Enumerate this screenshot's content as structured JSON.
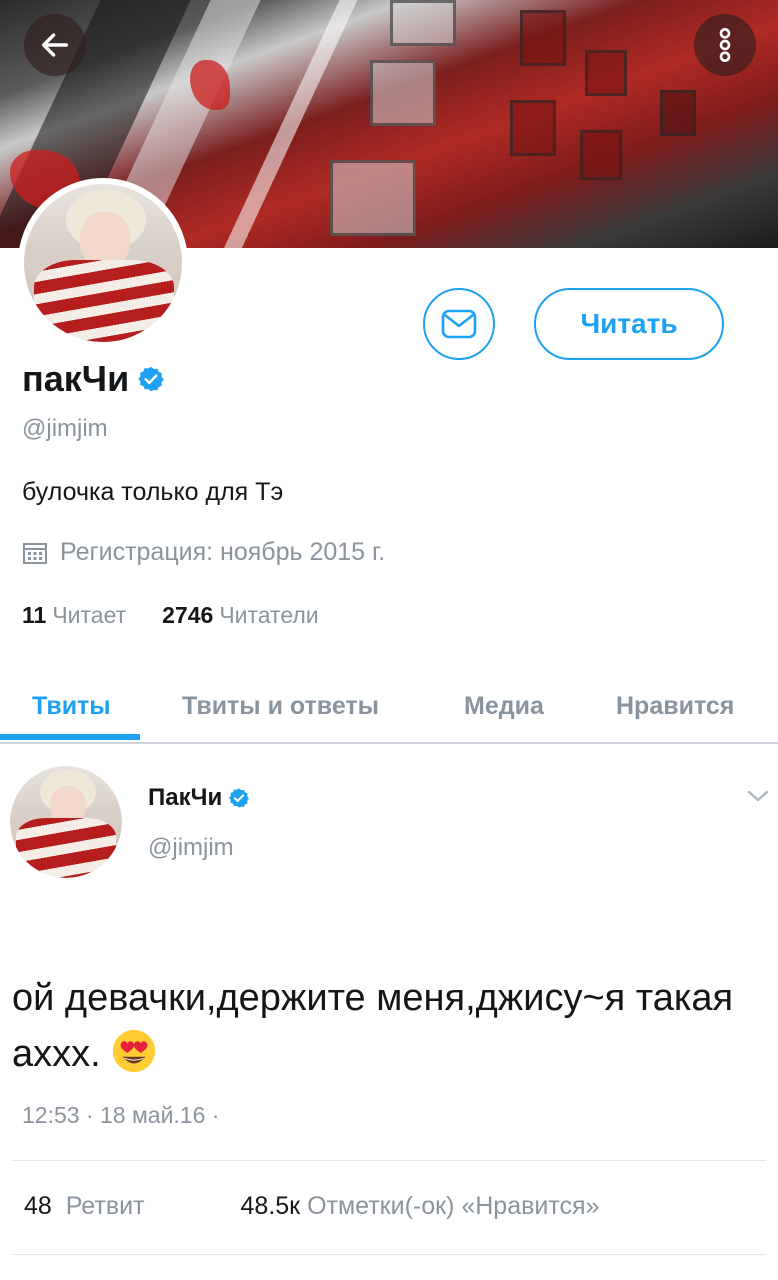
{
  "header": {
    "back_icon": "arrow-left-icon",
    "menu_icon": "more-vertical-icon"
  },
  "profile": {
    "name": "пакЧи",
    "handle": "@jimjim",
    "bio": "булочка только для Тэ",
    "joined": "Регистрация: ноябрь 2015 г.",
    "following_count": "11",
    "following_label": "Читает",
    "followers_count": "2746",
    "followers_label": "Читатели",
    "follow_button": "Читать",
    "message_icon": "mail-icon",
    "verified_icon": "verified-badge-icon"
  },
  "tabs": [
    {
      "label": "Твиты",
      "active": true
    },
    {
      "label": "Твиты и ответы",
      "active": false
    },
    {
      "label": "Медиа",
      "active": false
    },
    {
      "label": "Нравится",
      "active": false
    }
  ],
  "tweet": {
    "name": "ПакЧи",
    "handle": "@jimjim",
    "text": "ой девачки,держите меня,джису~я такая ахxx.",
    "emoji": "heart-eyes-emoji",
    "time": "12:53 · 18 май.16 ·",
    "retweets_count": "48",
    "retweets_label": "Ретвит",
    "likes_count": "48.5к",
    "likes_label": "Отметки(-ок) «Нравится»"
  },
  "colors": {
    "accent": "#1da1f2",
    "muted": "#8a949e",
    "text": "#14171a"
  }
}
